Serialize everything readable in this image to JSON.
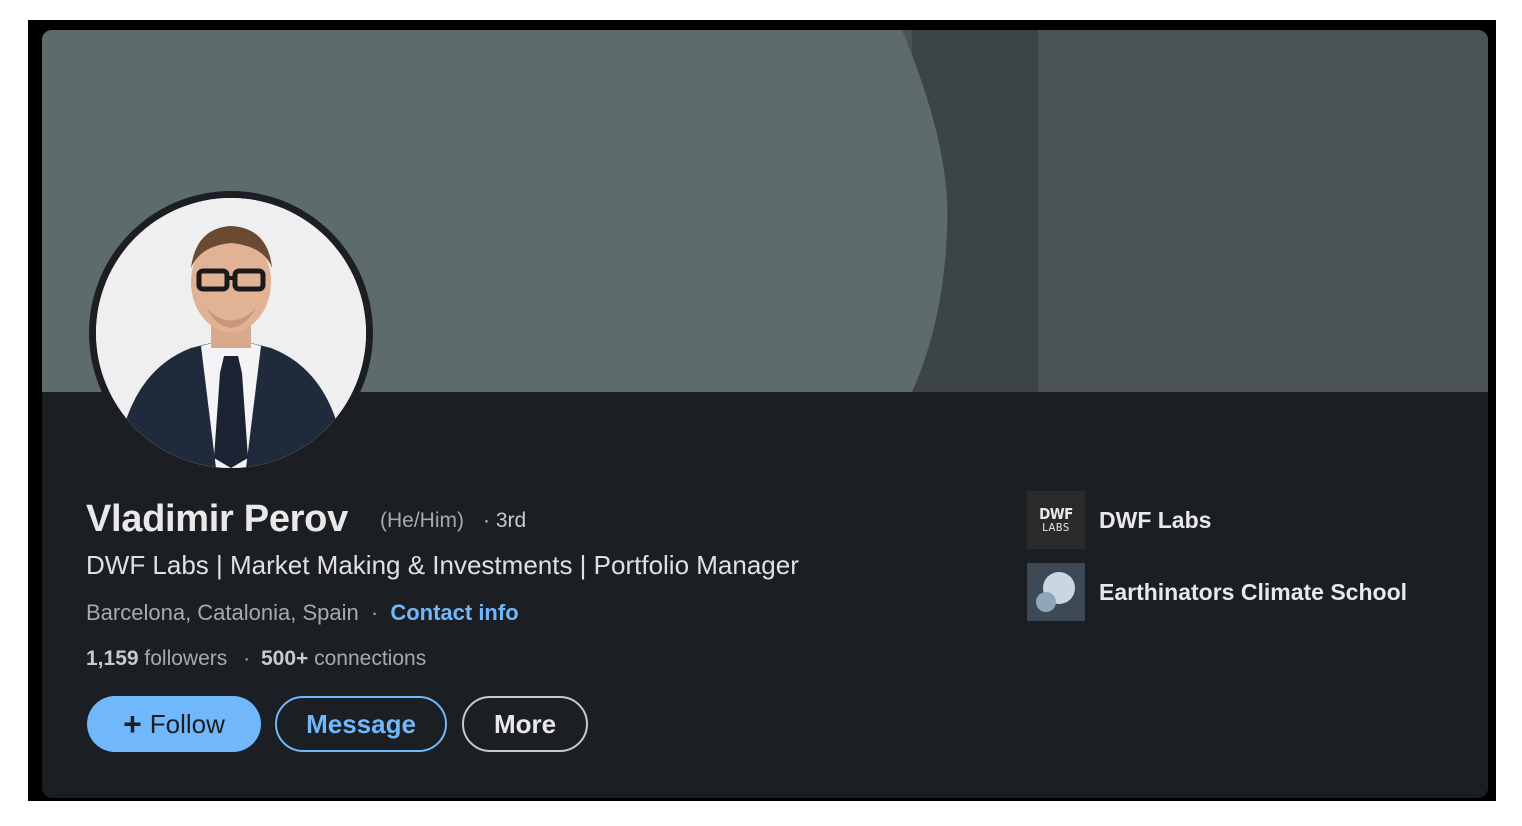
{
  "profile": {
    "name": "Vladimir Perov",
    "pronouns": "(He/Him)",
    "degree": "· 3rd",
    "headline": "DWF Labs | Market Making & Investments | Portfolio Manager",
    "location": "Barcelona, Catalonia, Spain",
    "separator": "·",
    "contact_info": "Contact info",
    "followers_count": "1,159",
    "followers_label": "followers",
    "stats_separator": "·",
    "connections_count": "500+",
    "connections_label": "connections"
  },
  "actions": {
    "follow_icon": "+",
    "follow_label": "Follow",
    "message_label": "Message",
    "more_label": "More"
  },
  "organizations": [
    {
      "name": "DWF Labs",
      "logo_top": "DWF",
      "logo_bottom": "LABS",
      "icon": "dwf-labs-logo"
    },
    {
      "name": "Earthinators Climate School",
      "icon": "earthinators-logo"
    }
  ],
  "colors": {
    "card_bg": "#1b1f23",
    "banner_light": "#5e6b6b",
    "banner_mid": "#3d4446",
    "banner_right": "#4b5254",
    "accent": "#71b7fb"
  }
}
